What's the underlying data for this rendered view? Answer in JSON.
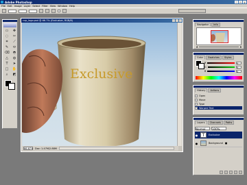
{
  "app": {
    "title": "Adobe Photoshop",
    "win_min": "_",
    "win_max": "□",
    "win_close": "×"
  },
  "menu": [
    "File",
    "Edit",
    "Image",
    "Layer",
    "Select",
    "Filter",
    "View",
    "Window",
    "Help"
  ],
  "document": {
    "title": "cup_logo.psd @ 66.7% (Exclusive, RGB/8)",
    "zoom": "66.67%",
    "status": "Doc: 1.47M/2.88M",
    "mug_text": "Exclusive"
  },
  "panels": {
    "navigator_tabs": [
      "Navigator",
      "Info"
    ],
    "color_tabs": [
      "Color",
      "Swatches",
      "Styles"
    ],
    "color_sliders": [
      {
        "label": "R",
        "value": "0",
        "color": "#d00000"
      },
      {
        "label": "G",
        "value": "0",
        "color": "#00a000"
      },
      {
        "label": "B",
        "value": "0",
        "color": "#0000d0"
      }
    ],
    "history_tabs": [
      "History",
      "Actions"
    ],
    "history_items": [
      "Open",
      "Move",
      "Type",
      "Warped Text"
    ],
    "layers_tabs": [
      "Layers",
      "Channels",
      "Paths"
    ],
    "layers": [
      {
        "name": "Exclusive",
        "type": "text",
        "selected": true
      },
      {
        "name": "Background",
        "type": "image",
        "selected": false
      }
    ],
    "layers_blend": "Normal",
    "layers_opacity": "100%"
  },
  "tools": [
    "▭",
    "✥",
    "◌",
    "✂",
    "⌗",
    "⟋",
    "✎",
    "⬭",
    "⌫",
    "◓",
    "△",
    "◍",
    "T",
    "➤",
    "□",
    "✋",
    "⌕",
    "◩"
  ],
  "colors": {
    "foreground": "#000000",
    "background": "#ffffff",
    "title_blue": "#0a246a",
    "workspace": "#7a7a7a"
  }
}
